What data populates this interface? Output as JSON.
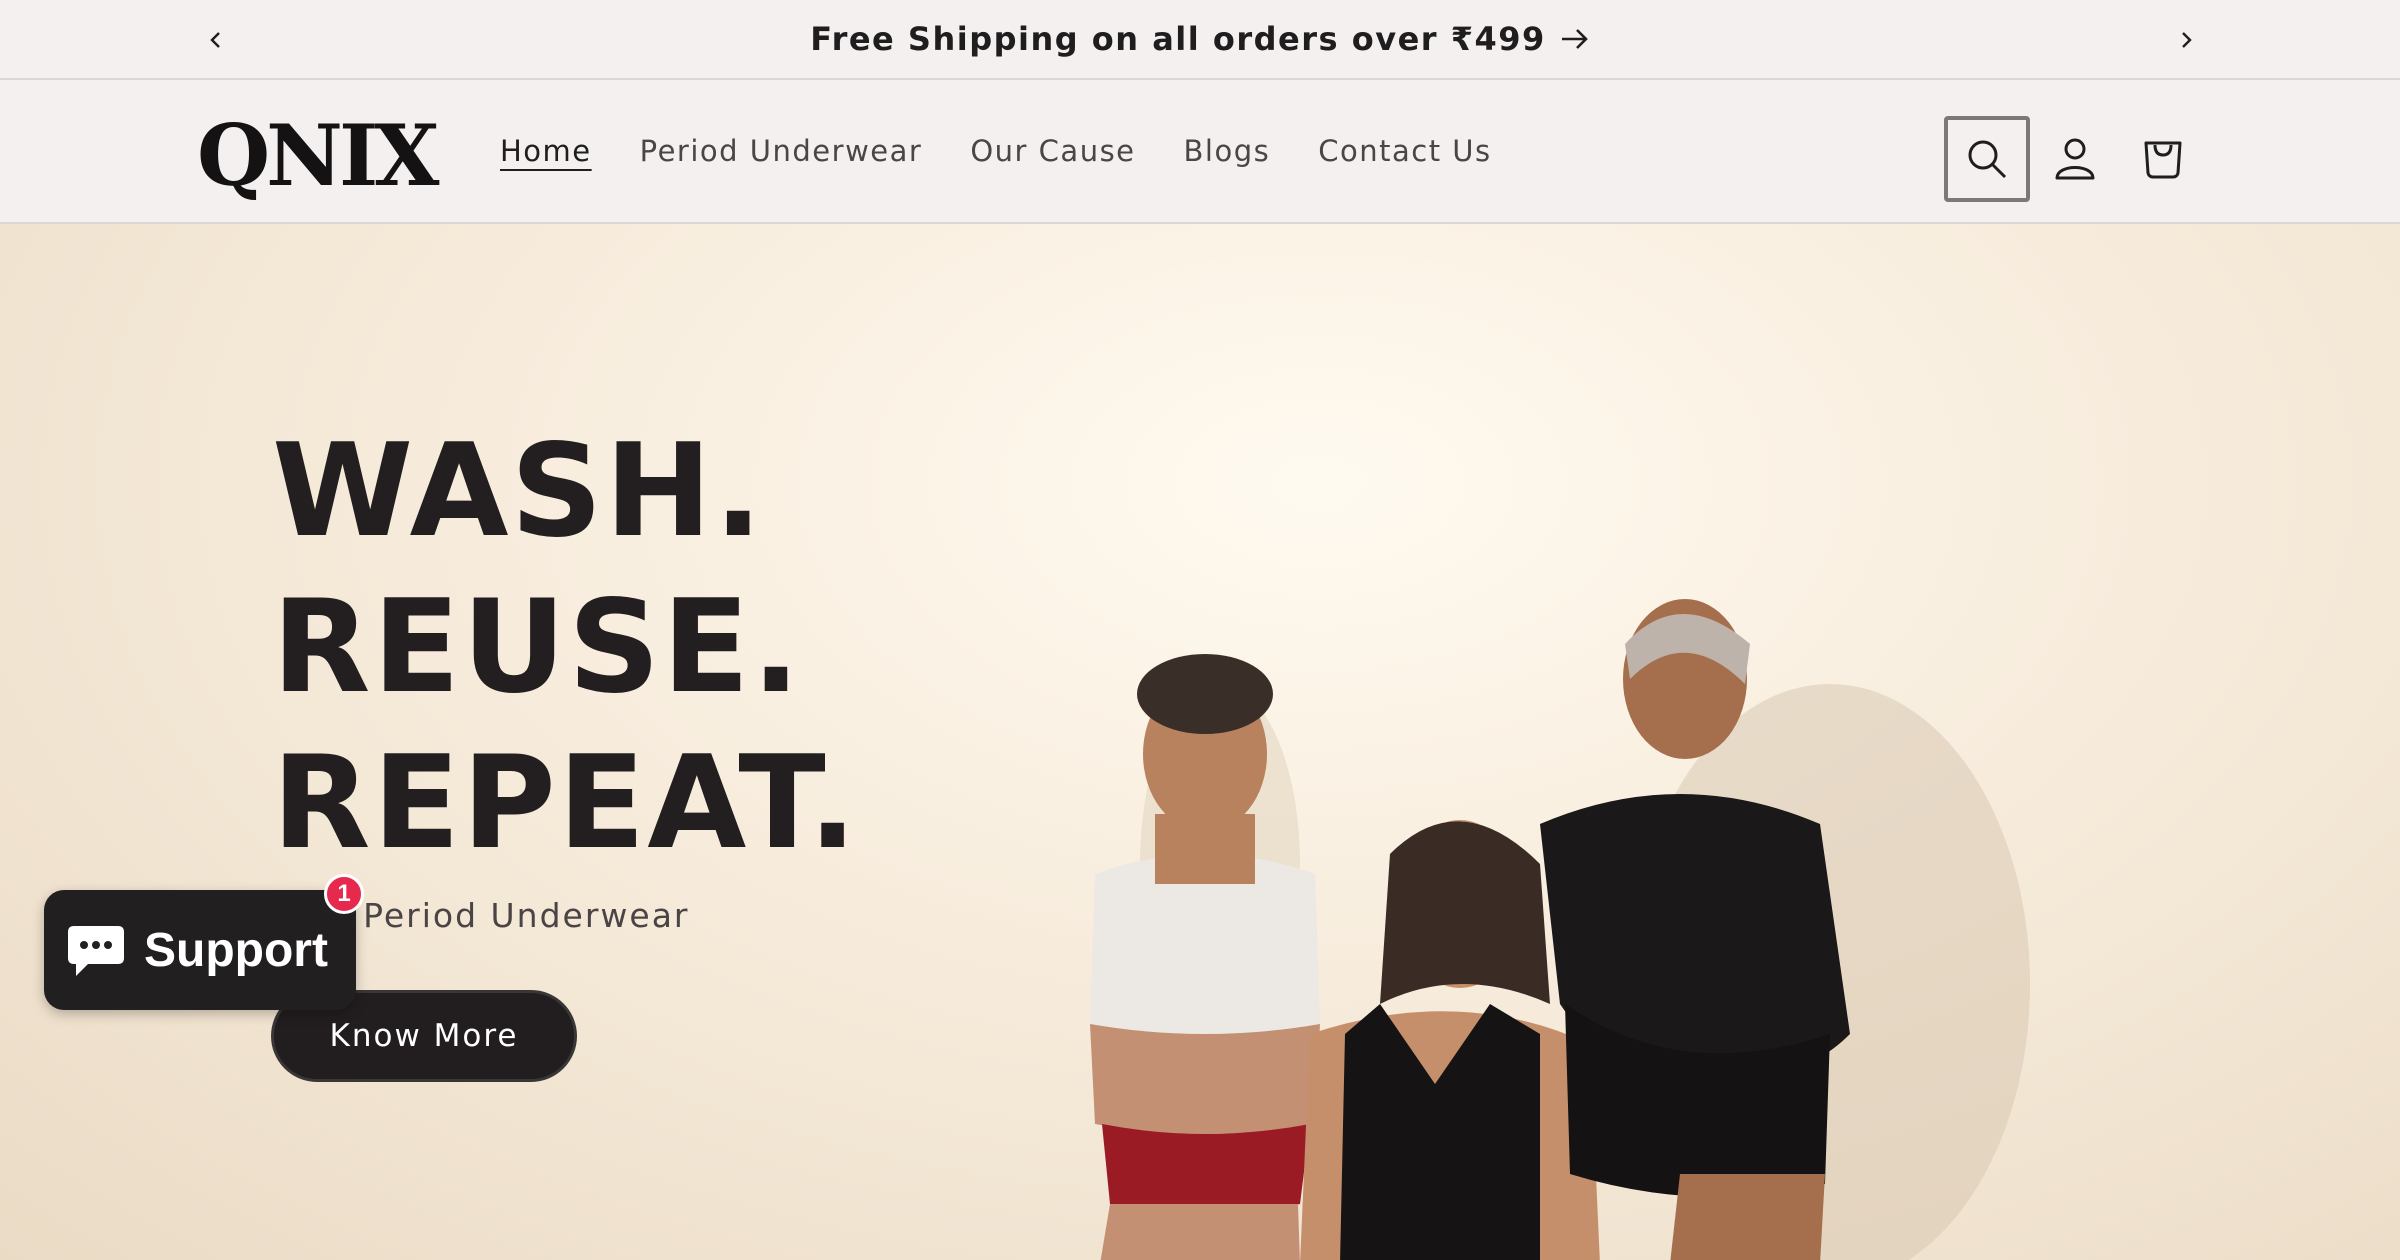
{
  "announcement": {
    "text": "Free Shipping on all orders over ₹499",
    "prev_icon": "chevron-left-icon",
    "next_icon": "chevron-right-icon",
    "arrow_icon": "arrow-right-icon"
  },
  "header": {
    "logo": "QNIX",
    "nav": [
      {
        "label": "Home",
        "active": true
      },
      {
        "label": "Period Underwear"
      },
      {
        "label": "Our Cause"
      },
      {
        "label": "Blogs"
      },
      {
        "label": "Contact Us"
      }
    ],
    "icons": [
      "search-icon",
      "account-icon",
      "cart-icon"
    ]
  },
  "hero": {
    "headline": [
      "WASH.",
      "REUSE.",
      "REPEAT."
    ],
    "subheadline": "able Period Underwear",
    "cta_label": "Know More"
  },
  "support_widget": {
    "label": "Support",
    "badge_count": "1",
    "icon": "chat-bubble-icon"
  },
  "colors": {
    "accent_dark": "#221e1f",
    "badge_red": "#e8294e",
    "bar_bg": "#f3f0ef"
  }
}
